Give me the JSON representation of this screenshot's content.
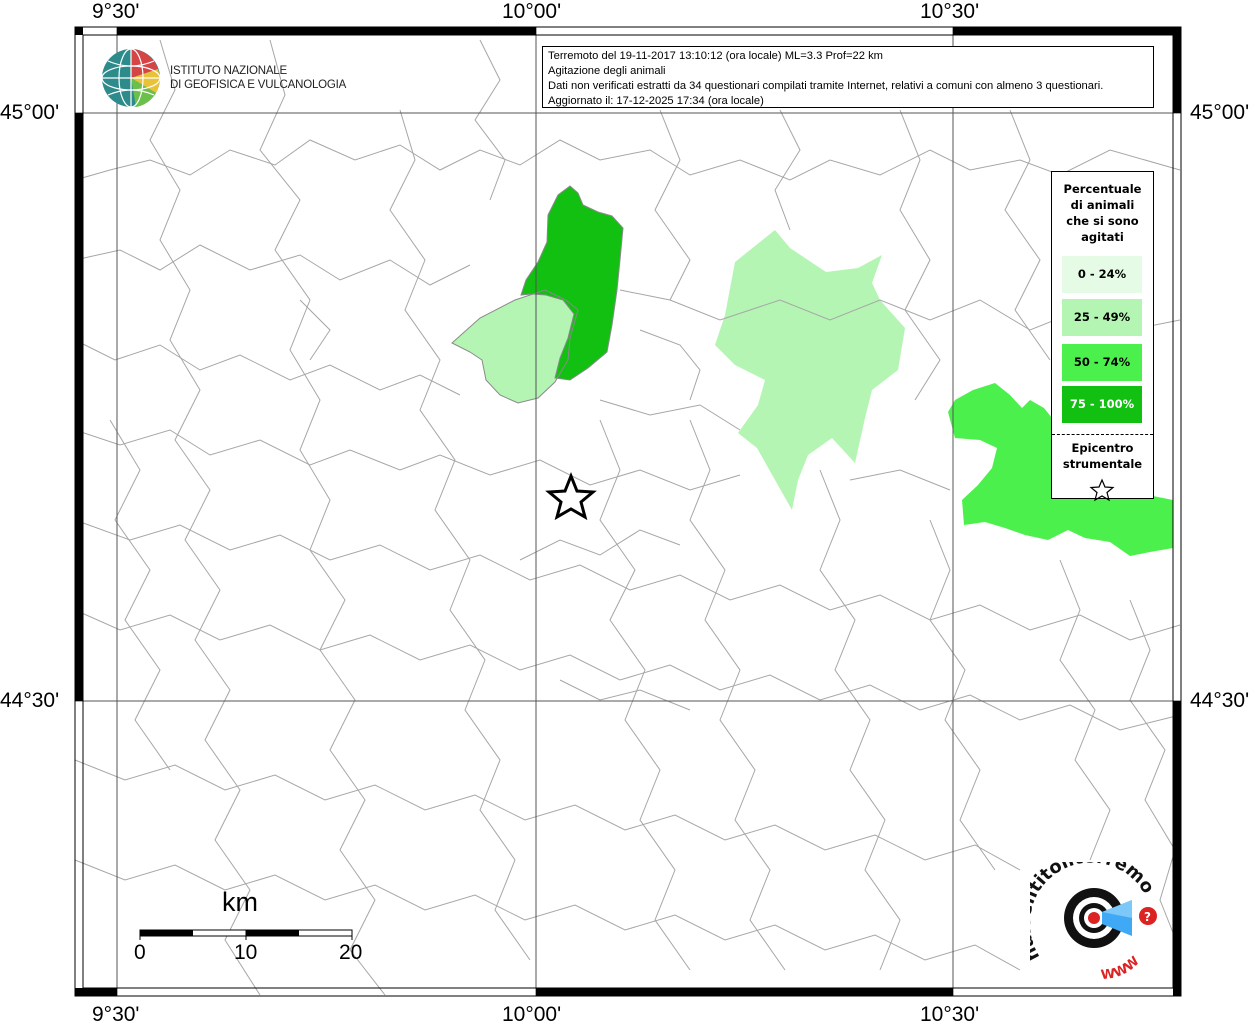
{
  "frame": {
    "top_labels": [
      "9°30'",
      "10°00'",
      "10°30'"
    ],
    "bottom_labels": [
      "9°30'",
      "10°00'",
      "10°30'"
    ],
    "left_labels": [
      "45°00'",
      "44°30'"
    ],
    "right_labels": [
      "45°00'",
      "44°30'"
    ]
  },
  "info": {
    "line1": "Terremoto del 19-11-2017 13:10:12 (ora locale) ML=3.3 Prof=22 km",
    "line2": "Agitazione degli animali",
    "line3": "Dati non verificati estratti da 34 questionari compilati tramite Internet, relativi a comuni con almeno 3 questionari.",
    "line4": "Aggiornato il: 17-12-2025 17:34 (ora locale)"
  },
  "ingv": {
    "line1": "ISTITUTO NAZIONALE",
    "line2": "DI GEOFISICA E VULCANOLOGIA"
  },
  "legend": {
    "title": [
      "Percentuale",
      "di animali",
      "che si sono",
      "agitati"
    ],
    "classes": [
      {
        "label": "0 - 24%",
        "color": "#e6fbe6",
        "text_color": "#000000"
      },
      {
        "label": "25 - 49%",
        "color": "#b4f5b4",
        "text_color": "#000000"
      },
      {
        "label": "50 - 74%",
        "color": "#4cf04c",
        "text_color": "#000000"
      },
      {
        "label": "75 - 100%",
        "color": "#12c012",
        "text_color": "#ffffff"
      }
    ],
    "epicenter": [
      "Epicentro",
      "strumentale"
    ]
  },
  "scale": {
    "unit": "km",
    "ticks": [
      "0",
      "10",
      "20"
    ]
  },
  "hsit_logo": {
    "text": "haisentitoilterremoto.it",
    "www": "WWW"
  },
  "colors": {
    "class_25_49": "#b4f5b4",
    "class_50_74": "#4cf04c",
    "class_75_100": "#12c012",
    "boundaries": "#a6a6a6",
    "frame": "#000000"
  }
}
